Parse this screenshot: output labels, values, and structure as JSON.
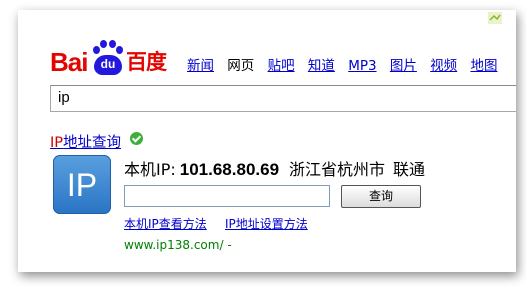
{
  "logo": {
    "bai": "Bai",
    "du": "du",
    "cn": "百度"
  },
  "nav": {
    "items": [
      "新闻",
      "网页",
      "贴吧",
      "知道",
      "MP3",
      "图片",
      "视频",
      "地图"
    ],
    "current_index": 1
  },
  "search": {
    "query": "ip"
  },
  "result": {
    "title_highlight": "IP",
    "title_rest": "地址查询",
    "ip_icon_label": "IP",
    "ip_label": "本机IP:",
    "ip_address": "101.68.80.69",
    "location": "浙江省杭州市",
    "isp": "联通",
    "query_input_value": "",
    "query_button": "查询",
    "link_view_method": "本机IP查看方法",
    "link_settings_method": "IP地址设置方法",
    "site_url": "www.ip138.com/ -"
  },
  "colors": {
    "brand_red": "#e10602",
    "brand_blue": "#2319dc",
    "link": "#0000cc",
    "url_green": "#008000"
  }
}
